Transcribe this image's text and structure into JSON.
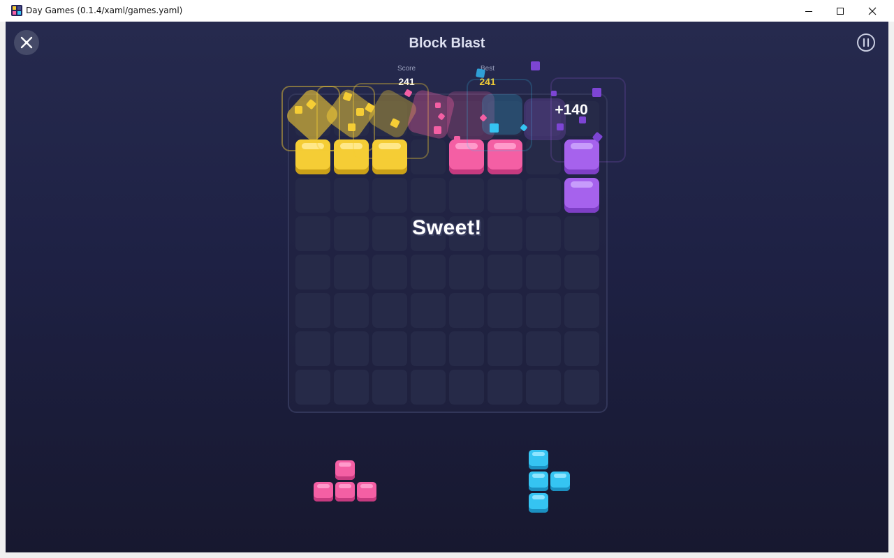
{
  "window": {
    "title": "Day Games (0.1.4/xaml/games.yaml)"
  },
  "game": {
    "title": "Block Blast",
    "score": {
      "label": "Score",
      "value": "241"
    },
    "best": {
      "label": "Best",
      "value": "241"
    },
    "combo_text": "Sweet!",
    "points_popup": "+140"
  },
  "board": {
    "rows": 8,
    "cols": 8,
    "filled": [
      {
        "row": 1,
        "col": 0,
        "color": "yellow"
      },
      {
        "row": 1,
        "col": 1,
        "color": "yellow"
      },
      {
        "row": 1,
        "col": 2,
        "color": "yellow"
      },
      {
        "row": 1,
        "col": 4,
        "color": "pink"
      },
      {
        "row": 1,
        "col": 5,
        "color": "pink"
      },
      {
        "row": 1,
        "col": 7,
        "color": "purple"
      },
      {
        "row": 2,
        "col": 7,
        "color": "purple"
      }
    ]
  },
  "tray": {
    "pieces": [
      {
        "name": "pink-t-piece",
        "color": "pink",
        "cells": [
          [
            0,
            1
          ],
          [
            1,
            0
          ],
          [
            1,
            1
          ],
          [
            1,
            2
          ]
        ]
      },
      {
        "name": "cyan-t-piece",
        "color": "cyan",
        "cells": [
          [
            0,
            0
          ],
          [
            1,
            0
          ],
          [
            1,
            1
          ],
          [
            2,
            0
          ]
        ]
      }
    ]
  },
  "colors": {
    "yellow": "#f5cd35",
    "pink": "#f45fa4",
    "purple": "#a662ed",
    "cyan": "#35c4f2",
    "background": "#1e2144",
    "best_value": "#f5cd35"
  },
  "icons": {
    "close": "close-icon",
    "pause": "pause-icon",
    "app": "app-icon",
    "minimize": "minimize-icon",
    "maximize": "maximize-icon",
    "window_close": "window-close-icon"
  }
}
